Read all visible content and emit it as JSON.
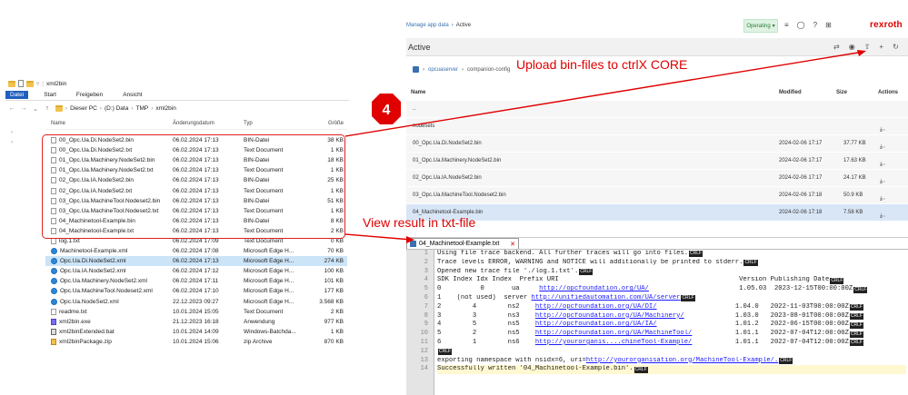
{
  "explorer": {
    "window_title": "xml2bin",
    "ribbon_tabs": [
      "Datei",
      "Start",
      "Freigeben",
      "Ansicht"
    ],
    "path": [
      "Dieser PC",
      "(D:) Data",
      "TMP",
      "xml2bin"
    ],
    "columns": {
      "name": "Name",
      "date": "Änderungsdatum",
      "type": "Typ",
      "size": "Größe"
    },
    "files": [
      {
        "name": "00_Opc.Ua.Di.NodeSet2.bin",
        "date": "06.02.2024 17:13",
        "type": "BIN-Datei",
        "size": "38 KB",
        "icon": "file"
      },
      {
        "name": "00_Opc.Ua.Di.NodeSet2.txt",
        "date": "06.02.2024 17:13",
        "type": "Text Document",
        "size": "1 KB",
        "icon": "file"
      },
      {
        "name": "01_Opc.Ua.Machinery.NodeSet2.bin",
        "date": "06.02.2024 17:13",
        "type": "BIN-Datei",
        "size": "18 KB",
        "icon": "file"
      },
      {
        "name": "01_Opc.Ua.Machinery.NodeSet2.txt",
        "date": "06.02.2024 17:13",
        "type": "Text Document",
        "size": "1 KB",
        "icon": "file"
      },
      {
        "name": "02_Opc.Ua.IA.NodeSet2.bin",
        "date": "06.02.2024 17:13",
        "type": "BIN-Datei",
        "size": "25 KB",
        "icon": "file"
      },
      {
        "name": "02_Opc.Ua.IA.NodeSet2.txt",
        "date": "06.02.2024 17:13",
        "type": "Text Document",
        "size": "1 KB",
        "icon": "file"
      },
      {
        "name": "03_Opc.Ua.MachineTool.Nodeset2.bin",
        "date": "06.02.2024 17:13",
        "type": "BIN-Datei",
        "size": "51 KB",
        "icon": "file"
      },
      {
        "name": "03_Opc.Ua.MachineTool.Nodeset2.txt",
        "date": "06.02.2024 17:13",
        "type": "Text Document",
        "size": "1 KB",
        "icon": "file"
      },
      {
        "name": "04_Machinetool-Example.bin",
        "date": "06.02.2024 17:13",
        "type": "BIN-Datei",
        "size": "8 KB",
        "icon": "file"
      },
      {
        "name": "04_Machinetool-Example.txt",
        "date": "06.02.2024 17:13",
        "type": "Text Document",
        "size": "2 KB",
        "icon": "file"
      },
      {
        "name": "log.1.txt",
        "date": "06.02.2024 17:09",
        "type": "Text Document",
        "size": "0 KB",
        "icon": "file"
      },
      {
        "name": "Machinetool-Example.xml",
        "date": "06.02.2024 17:08",
        "type": "Microsoft Edge H...",
        "size": "70 KB",
        "icon": "xml"
      },
      {
        "name": "Opc.Ua.Di.NodeSet2.xml",
        "date": "06.02.2024 17:13",
        "type": "Microsoft Edge H...",
        "size": "274 KB",
        "icon": "xml",
        "selected": true
      },
      {
        "name": "Opc.Ua.IA.NodeSet2.xml",
        "date": "06.02.2024 17:12",
        "type": "Microsoft Edge H...",
        "size": "100 KB",
        "icon": "xml"
      },
      {
        "name": "Opc.Ua.Machinery.NodeSet2.xml",
        "date": "06.02.2024 17:11",
        "type": "Microsoft Edge H...",
        "size": "101 KB",
        "icon": "xml"
      },
      {
        "name": "Opc.Ua.MachineTool.Nodeset2.xml",
        "date": "06.02.2024 17:10",
        "type": "Microsoft Edge H...",
        "size": "177 KB",
        "icon": "xml"
      },
      {
        "name": "Opc.Ua.NodeSet2.xml",
        "date": "22.12.2023 09:27",
        "type": "Microsoft Edge H...",
        "size": "3.568 KB",
        "icon": "xml"
      },
      {
        "name": "readme.txt",
        "date": "10.01.2024 15:05",
        "type": "Text Document",
        "size": "2 KB",
        "icon": "file"
      },
      {
        "name": "xml2bin.exe",
        "date": "21.12.2023 16:18",
        "type": "Anwendung",
        "size": "977 KB",
        "icon": "exe"
      },
      {
        "name": "xml2binExtended.bat",
        "date": "10.01.2024 14:09",
        "type": "Windows-Batchda...",
        "size": "1 KB",
        "icon": "bat"
      },
      {
        "name": "xml2binPackage.zip",
        "date": "10.01.2024 15:06",
        "type": "zip Archive",
        "size": "870 KB",
        "icon": "zip"
      }
    ]
  },
  "web": {
    "breadcrumb": [
      "Manage app data",
      "Active"
    ],
    "status": "Operating",
    "brand": "rexroth",
    "page_title": "Active",
    "path": [
      "opcuaserver",
      "companion-config"
    ],
    "columns": {
      "name": "Name",
      "modified": "Modified",
      "size": "Size",
      "actions": "Actions"
    },
    "rows": [
      {
        "name": "..",
        "modified": "",
        "size": "",
        "kind": "up"
      },
      {
        "name": "nodesets",
        "modified": "",
        "size": "",
        "kind": "folder"
      },
      {
        "name": "00_Opc.Ua.Di.NodeSet2.bin",
        "modified": "2024-02-06 17:17",
        "size": "37.77 KB",
        "kind": "file"
      },
      {
        "name": "01_Opc.Ua.Machinery.NodeSet2.bin",
        "modified": "2024-02-06 17:17",
        "size": "17.63 KB",
        "kind": "file"
      },
      {
        "name": "02_Opc.Ua.IA.NodeSet2.bin",
        "modified": "2024-02-06 17:17",
        "size": "24.17 KB",
        "kind": "file"
      },
      {
        "name": "03_Opc.Ua.MachineTool.Nodeset2.bin",
        "modified": "2024-02-06 17:18",
        "size": "50.9 KB",
        "kind": "file"
      },
      {
        "name": "04_Machinetool-Example.bin",
        "modified": "2024-02-06 17:18",
        "size": "7.58 KB",
        "kind": "file",
        "selected": true
      }
    ]
  },
  "editor": {
    "tab_label": "04_Machinetool-Example.txt",
    "line_end_marker": "CRLF",
    "lines": [
      "Using file trace backend. All further traces will go into files.",
      "Trace levels ERROR, WARNING and NOTICE will additionally be printed to stderr.",
      "Opened new trace file './log.1.txt'.",
      "SDK Index Idx Index  Prefix URI                                              Version Publishing Date",
      "0          0       ua     http://opcfoundation.org/UA/                       1.05.03  2023-12-15T00:00:00Z",
      "1    (not used)  server http://unifiedautomation.com/UA/server",
      "2        4        ns2    http://opcfoundation.org/UA/DI/                    1.04.0   2022-11-03T00:00:00Z",
      "3        3        ns3    http://opcfoundation.org/UA/Machinery/             1.03.0   2023-08-01T00:00:00Z",
      "4        5        ns5    http://opcfoundation.org/UA/IA/                    1.01.2   2022-06-15T00:00:00Z",
      "5        2        ns5    http://opcfoundation.org/UA/MachineTool/           1.01.1   2022-07-04T12:00:00Z",
      "6        1        ns6    http://yourorganis....chineTool-Example/           1.01.1   2022-07-04T12:00:00Z",
      "",
      "exporting namespace with nsidx=6, uri=http://yourorganisation.org/MachineTool-Example/.",
      "Successfully written '04_Machinetool-Example.bin'."
    ]
  },
  "annotations": {
    "upload": "Upload bin-files to ctrlX CORE",
    "view": "View result in txt-file",
    "step": "4"
  },
  "colors": {
    "accent_red": "#e00000",
    "selection_blue": "#cce4f7",
    "web_selected": "#d9e6f6"
  }
}
